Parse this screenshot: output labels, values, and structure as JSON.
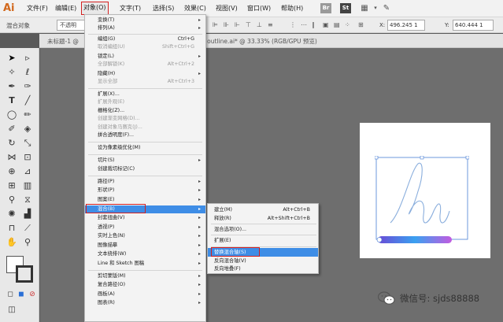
{
  "menubar": {
    "logo": "Ai",
    "items": [
      "文件(F)",
      "编辑(E)",
      "对象(O)",
      "文字(T)",
      "选择(S)",
      "效果(C)",
      "视图(V)",
      "窗口(W)",
      "帮助(H)"
    ],
    "icon_br": "Br",
    "icon_st": "St"
  },
  "controlbar": {
    "label": "混合对象",
    "opacity_value": "不透明",
    "x_label": "X:",
    "x_value": "496.245 1",
    "y_label": "Y:",
    "y_value": "640.444 1"
  },
  "tabs": {
    "untitled": "未标题-1 @",
    "active": "g outline.ai* @ 33.33% (RGB/GPU 预览)"
  },
  "object_menu": {
    "items": [
      {
        "label": "变换(T)",
        "arrow": true,
        "disabled": false,
        "sc": ""
      },
      {
        "label": "排列(A)",
        "arrow": true,
        "disabled": false,
        "sc": ""
      },
      {
        "label": "编组(G)",
        "arrow": false,
        "disabled": false,
        "sc": "Ctrl+G"
      },
      {
        "label": "取消编组(U)",
        "arrow": false,
        "disabled": true,
        "sc": "Shift+Ctrl+G"
      },
      {
        "label": "锁定(L)",
        "arrow": true,
        "disabled": false,
        "sc": ""
      },
      {
        "label": "全部解锁(K)",
        "arrow": false,
        "disabled": true,
        "sc": "Alt+Ctrl+2"
      },
      {
        "label": "隐藏(H)",
        "arrow": true,
        "disabled": false,
        "sc": ""
      },
      {
        "label": "显示全部",
        "arrow": false,
        "disabled": true,
        "sc": "Alt+Ctrl+3"
      },
      {
        "label": "扩展(X)...",
        "arrow": false,
        "disabled": false,
        "sc": ""
      },
      {
        "label": "扩展外观(E)",
        "arrow": false,
        "disabled": true,
        "sc": ""
      },
      {
        "label": "栅格化(Z)...",
        "arrow": false,
        "disabled": false,
        "sc": ""
      },
      {
        "label": "创建渐变网格(D)...",
        "arrow": false,
        "disabled": true,
        "sc": ""
      },
      {
        "label": "创建对象马赛克(J)...",
        "arrow": false,
        "disabled": true,
        "sc": ""
      },
      {
        "label": "拼合透明度(F)...",
        "arrow": false,
        "disabled": false,
        "sc": ""
      },
      {
        "label": "设为像素级优化(M)",
        "arrow": false,
        "disabled": false,
        "sc": ""
      },
      {
        "label": "切片(S)",
        "arrow": true,
        "disabled": false,
        "sc": ""
      },
      {
        "label": "创建裁切标记(C)",
        "arrow": false,
        "disabled": false,
        "sc": ""
      },
      {
        "label": "路径(P)",
        "arrow": true,
        "disabled": false,
        "sc": ""
      },
      {
        "label": "形状(P)",
        "arrow": true,
        "disabled": false,
        "sc": ""
      },
      {
        "label": "图案(E)",
        "arrow": true,
        "disabled": false,
        "sc": ""
      },
      {
        "label": "混合(B)",
        "arrow": true,
        "disabled": false,
        "sc": ""
      },
      {
        "label": "封套扭曲(V)",
        "arrow": true,
        "disabled": false,
        "sc": ""
      },
      {
        "label": "透视(P)",
        "arrow": true,
        "disabled": false,
        "sc": ""
      },
      {
        "label": "实时上色(N)",
        "arrow": true,
        "disabled": false,
        "sc": ""
      },
      {
        "label": "图像描摹",
        "arrow": true,
        "disabled": false,
        "sc": ""
      },
      {
        "label": "文本绕排(W)",
        "arrow": true,
        "disabled": false,
        "sc": ""
      },
      {
        "label": "Line 和 Sketch 图稿",
        "arrow": true,
        "disabled": false,
        "sc": ""
      },
      {
        "label": "剪切蒙版(M)",
        "arrow": true,
        "disabled": false,
        "sc": ""
      },
      {
        "label": "复合路径(O)",
        "arrow": true,
        "disabled": false,
        "sc": ""
      },
      {
        "label": "画板(A)",
        "arrow": true,
        "disabled": false,
        "sc": ""
      },
      {
        "label": "图表(R)",
        "arrow": true,
        "disabled": false,
        "sc": ""
      }
    ]
  },
  "blend_submenu": {
    "items": [
      {
        "label": "建立(M)",
        "sc": "Alt+Ctrl+B"
      },
      {
        "label": "释放(R)",
        "sc": "Alt+Shift+Ctrl+B"
      },
      {
        "label": "混合选项(O)...",
        "sc": ""
      },
      {
        "label": "扩展(E)",
        "sc": ""
      },
      {
        "label": "替换混合轴(S)",
        "sc": ""
      },
      {
        "label": "反向混合轴(V)",
        "sc": ""
      },
      {
        "label": "反向堆叠(F)",
        "sc": ""
      }
    ]
  },
  "watermark": {
    "text": "微信号: sjds88888"
  },
  "colors": {
    "highlight": "#3e8de6",
    "annotation_red": "#d32020",
    "logo": "#d2691e"
  }
}
